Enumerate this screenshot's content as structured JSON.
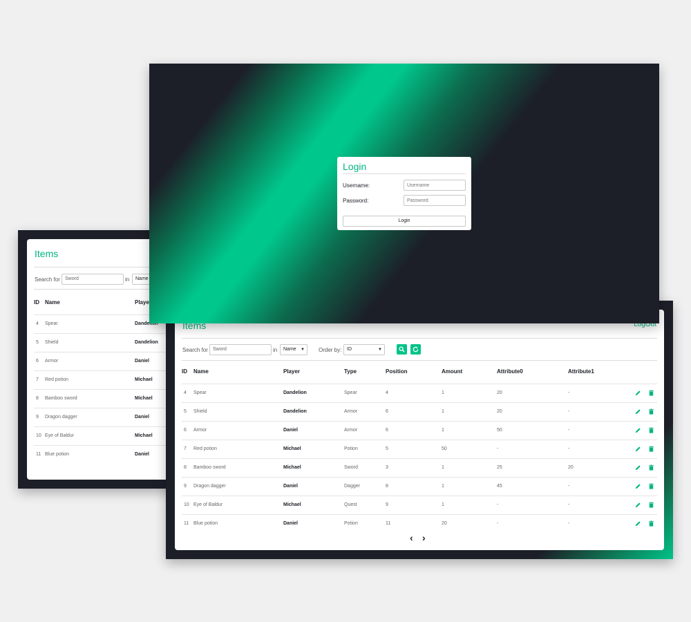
{
  "items_left": {
    "title": "Items",
    "search_label": "Search for",
    "search_value": "Sword",
    "in_label": "in",
    "field_value": "Name",
    "columns": [
      "ID",
      "Name",
      "Player"
    ],
    "rows": [
      [
        "4",
        "Spear",
        "Dandelion"
      ],
      [
        "5",
        "Shield",
        "Dandelion"
      ],
      [
        "6",
        "Armor",
        "Daniel"
      ],
      [
        "7",
        "Red potion",
        "Michael"
      ],
      [
        "8",
        "Bamboo sword",
        "Michael"
      ],
      [
        "9",
        "Dragon dagger",
        "Daniel"
      ],
      [
        "10",
        "Eye of Baldur",
        "Michael"
      ],
      [
        "11",
        "Blue potion",
        "Daniel"
      ]
    ]
  },
  "items_main": {
    "title": "Items",
    "logout_label": "LogOut",
    "search_label": "Search for",
    "search_value": "Sword",
    "in_label": "in",
    "field_value": "Name",
    "order_label": "Order by:",
    "order_value": "ID",
    "columns": [
      "ID",
      "Name",
      "Player",
      "Type",
      "Position",
      "Amount",
      "Attribute0",
      "Attribute1"
    ],
    "rows": [
      [
        "4",
        "Spear",
        "Dandelion",
        "Spear",
        "4",
        "1",
        "20",
        "-"
      ],
      [
        "5",
        "Shield",
        "Dandelion",
        "Armor",
        "6",
        "1",
        "20",
        "-"
      ],
      [
        "6",
        "Armor",
        "Daniel",
        "Armor",
        "6",
        "1",
        "50",
        "-"
      ],
      [
        "7",
        "Red potion",
        "Michael",
        "Potion",
        "5",
        "50",
        "-",
        "-"
      ],
      [
        "8",
        "Bamboo sword",
        "Michael",
        "Sword",
        "3",
        "1",
        "25",
        "20"
      ],
      [
        "9",
        "Dragon dagger",
        "Daniel",
        "Dagger",
        "8",
        "1",
        "45",
        "-"
      ],
      [
        "10",
        "Eye of Baldur",
        "Michael",
        "Quest",
        "9",
        "1",
        "-",
        "-"
      ],
      [
        "11",
        "Blue potion",
        "Daniel",
        "Potion",
        "11",
        "20",
        "-",
        "-"
      ]
    ],
    "pager_prev": "‹",
    "pager_next": "›"
  },
  "login": {
    "title": "Login",
    "username_label": "Username:",
    "username_placeholder": "Username",
    "password_label": "Password:",
    "password_placeholder": "Password",
    "button_label": "Login"
  },
  "icons": {
    "edit": "pencil-icon",
    "delete": "trash-icon",
    "search": "search-icon",
    "reset": "refresh-icon"
  },
  "colors": {
    "accent": "#00c389",
    "dark_bg": "#1c1f28"
  }
}
